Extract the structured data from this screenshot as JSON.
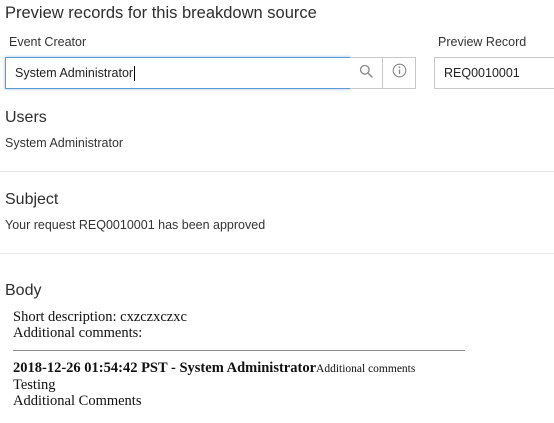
{
  "page": {
    "heading": "Preview records for this breakdown source"
  },
  "event_creator": {
    "label": "Event Creator",
    "value": "System Administrator"
  },
  "preview_record": {
    "label": "Preview Record",
    "value": "REQ0010001"
  },
  "icons": {
    "search": "search-icon",
    "info": "info-icon"
  },
  "users": {
    "heading": "Users",
    "value": "System Administrator"
  },
  "subject": {
    "heading": "Subject",
    "value": "Your request REQ0010001 has been approved"
  },
  "body": {
    "heading": "Body",
    "short_description": "Short description: cxzczxczxc",
    "additional_comments_label": "Additional comments:",
    "journal": {
      "stamp": "2018-12-26 01:54:42 PST - System Administrator",
      "kind": "Additional comments",
      "lines": [
        "Testing",
        "Additional Comments"
      ]
    }
  },
  "colors": {
    "focus_border": "#5b9bd5",
    "border": "#c8c8c8",
    "icon": "#888888"
  }
}
